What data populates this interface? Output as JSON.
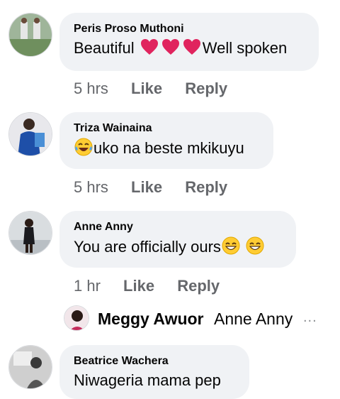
{
  "comments": [
    {
      "author": "Peris Proso Muthoni",
      "text_before": "Beautiful",
      "text_after": "Well spoken",
      "emojis": [
        "red-heart",
        "red-heart",
        "red-heart"
      ],
      "time": "5 hrs",
      "like": "Like",
      "reply": "Reply"
    },
    {
      "author": "Triza Wainaina",
      "text_after": "uko na beste mkikuyu",
      "emojis": [
        "tears-of-joy"
      ],
      "time": "5 hrs",
      "like": "Like",
      "reply": "Reply"
    },
    {
      "author": "Anne Anny",
      "text_before": "You are officially ours",
      "emojis": [
        "grinning-smiling-eyes",
        "grinning-smiling-eyes"
      ],
      "time": "1 hr",
      "like": "Like",
      "reply": "Reply"
    },
    {
      "author": "Beatrice Wachera",
      "text_before": "Niwageria mama pep"
    }
  ],
  "reply_preview": {
    "author": "Meggy Awuor",
    "mention": "Anne Anny",
    "more": "..."
  },
  "colors": {
    "bubble": "#f0f2f5",
    "text": "#050505",
    "meta": "#65676b",
    "heart": "#e0245e",
    "emoji_face": "#ffcc33"
  }
}
